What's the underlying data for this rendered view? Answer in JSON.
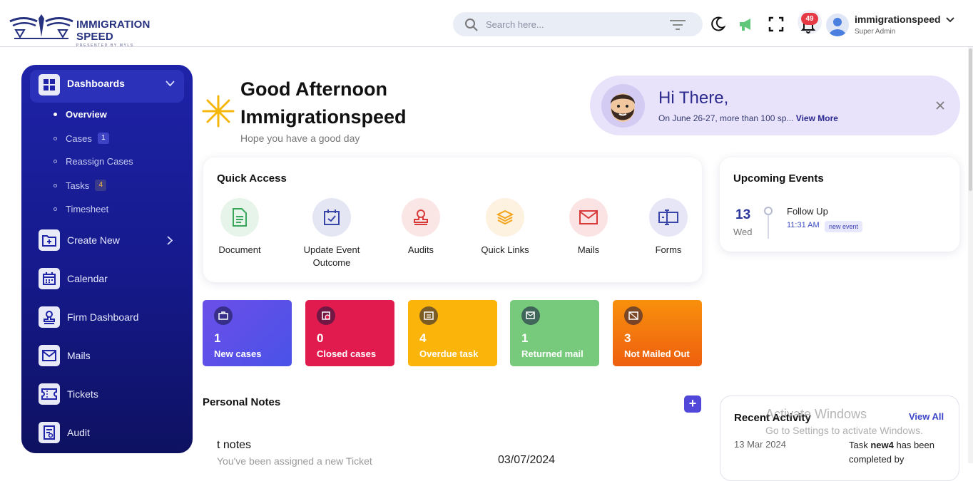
{
  "brand": {
    "name": "IMMIGRATION SPEED",
    "tagline": "PRESENTED BY MYLS"
  },
  "topbar": {
    "search_placeholder": "Search here...",
    "notification_count": "49",
    "user_name": "immigrationspeed",
    "user_role": "Super Admin"
  },
  "sidebar": {
    "dashboards": "Dashboards",
    "sub_items": [
      {
        "label": "Overview",
        "badge": ""
      },
      {
        "label": "Cases",
        "badge": "1"
      },
      {
        "label": "Reassign Cases",
        "badge": ""
      },
      {
        "label": "Tasks",
        "badge": "4"
      },
      {
        "label": "Timesheet",
        "badge": ""
      }
    ],
    "create_new": "Create New",
    "calendar": "Calendar",
    "firm_dashboard": "Firm Dashboard",
    "mails": "Mails",
    "tickets": "Tickets",
    "audit": "Audit"
  },
  "greeting": {
    "line1": "Good Afternoon",
    "line2": "Immigrationspeed",
    "sub": "Hope you have a good day"
  },
  "hi_card": {
    "title": "Hi There,",
    "text": "On June 26-27, more than 100 sp...",
    "more": "View More"
  },
  "quick_access": {
    "title": "Quick Access",
    "items": [
      {
        "label": "Document"
      },
      {
        "label": "Update Event Outcome"
      },
      {
        "label": "Audits"
      },
      {
        "label": "Quick Links"
      },
      {
        "label": "Mails"
      },
      {
        "label": "Forms"
      }
    ]
  },
  "events": {
    "title": "Upcoming Events",
    "day": "13",
    "weekday": "Wed",
    "event_title": "Follow Up",
    "time": "11:31 AM",
    "badge": "new event"
  },
  "stats": [
    {
      "value": "1",
      "label": "New cases",
      "color": "#5a4fe6"
    },
    {
      "value": "0",
      "label": "Closed cases",
      "color": "#e21b4f"
    },
    {
      "value": "4",
      "label": "Overdue task",
      "color": "#fbb40a"
    },
    {
      "value": "1",
      "label": "Returned mail",
      "color": "#77c97c"
    },
    {
      "value": "3",
      "label": "Not Mailed Out",
      "color": "#f46f10"
    }
  ],
  "notes": {
    "title": "Personal Notes",
    "add": "+",
    "item_title": "t notes",
    "item_sub": "You've been assigned a new Ticket",
    "item_date": "03/07/2024"
  },
  "recent_activity": {
    "title": "Recent Activity",
    "view_all": "View All",
    "date": "13 Mar 2024",
    "text_pre": "Task ",
    "text_strong": "new4",
    "text_post": " has been completed by"
  },
  "watermark": {
    "line1": "Activate Windows",
    "line2": "Go to Settings to activate Windows."
  }
}
